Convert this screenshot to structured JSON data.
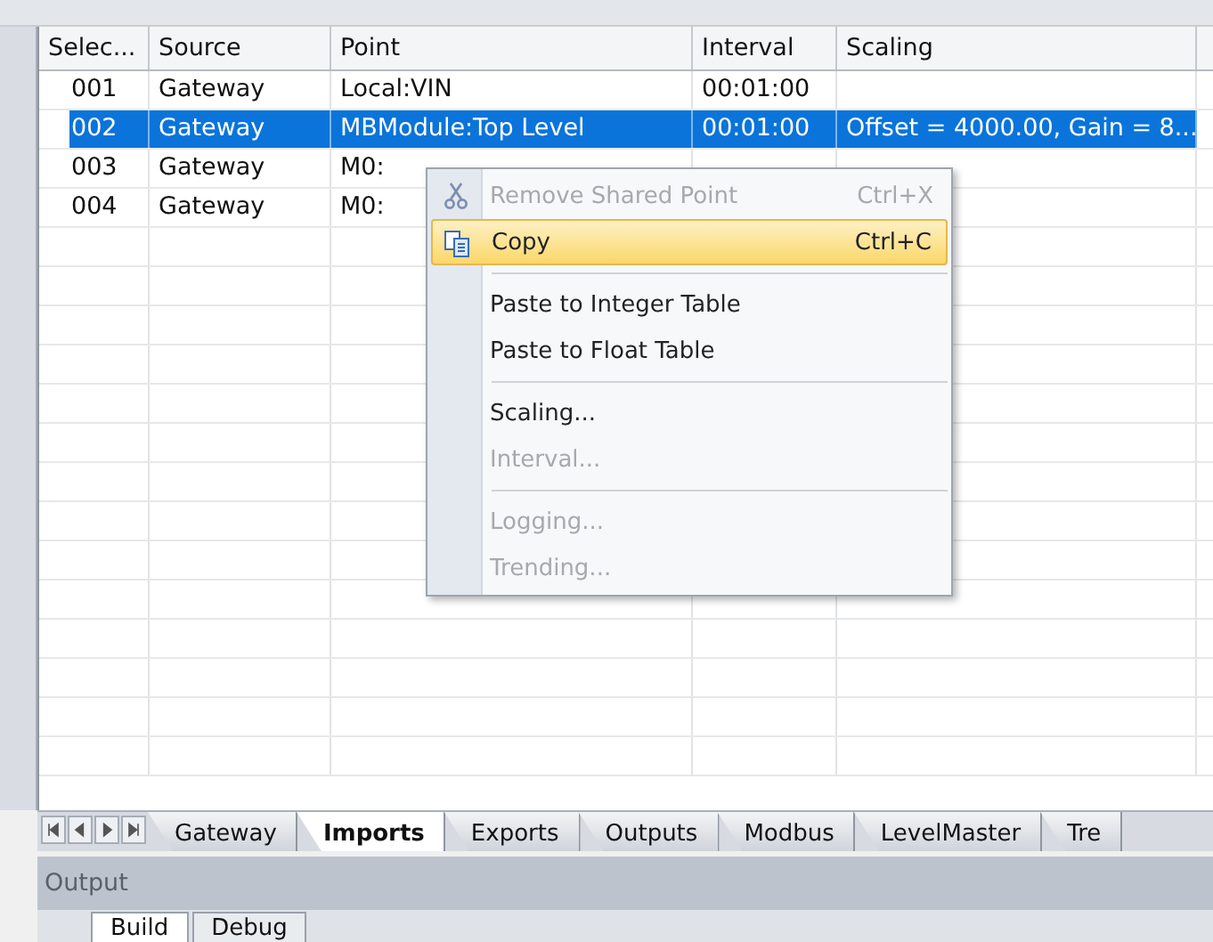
{
  "table": {
    "columns": [
      "Selec...",
      "Source",
      "Point",
      "Interval",
      "Scaling"
    ],
    "rows": [
      {
        "cells": [
          "001",
          "Gateway",
          "Local:VIN",
          "00:01:00",
          ""
        ],
        "selected": false
      },
      {
        "cells": [
          "002",
          "Gateway",
          "MBModule:Top Level",
          "00:01:00",
          "Offset = 4000.00, Gain = 8..."
        ],
        "selected": true
      },
      {
        "cells": [
          "003",
          "Gateway",
          "M0:",
          "",
          ""
        ],
        "selected": false
      },
      {
        "cells": [
          "004",
          "Gateway",
          "M0:",
          "",
          ""
        ],
        "selected": false
      }
    ]
  },
  "context_menu": {
    "items": [
      {
        "kind": "item",
        "label": "Remove Shared Point",
        "shortcut": "Ctrl+X",
        "disabled": true,
        "selected": false
      },
      {
        "kind": "item",
        "label": "Copy",
        "shortcut": "Ctrl+C",
        "disabled": false,
        "selected": true
      },
      {
        "kind": "separator"
      },
      {
        "kind": "item",
        "label": "Paste to Integer Table",
        "disabled": false,
        "selected": false
      },
      {
        "kind": "item",
        "label": "Paste to Float Table",
        "disabled": false,
        "selected": false
      },
      {
        "kind": "separator"
      },
      {
        "kind": "item",
        "label": "Scaling...",
        "disabled": false,
        "selected": false
      },
      {
        "kind": "item",
        "label": "Interval...",
        "disabled": true,
        "selected": false
      },
      {
        "kind": "separator"
      },
      {
        "kind": "item",
        "label": "Logging...",
        "disabled": true,
        "selected": false
      },
      {
        "kind": "item",
        "label": "Trending...",
        "disabled": true,
        "selected": false
      }
    ]
  },
  "sheet_tabs": [
    {
      "label": "Gateway",
      "selected": false
    },
    {
      "label": "Imports",
      "selected": true
    },
    {
      "label": "Exports",
      "selected": false
    },
    {
      "label": "Outputs",
      "selected": false
    },
    {
      "label": "Modbus",
      "selected": false
    },
    {
      "label": "LevelMaster",
      "selected": false
    },
    {
      "label": "Tre",
      "selected": false
    }
  ],
  "output_panel": {
    "title": "Output",
    "tabs": [
      {
        "label": "Build",
        "selected": true
      },
      {
        "label": "Debug",
        "selected": false
      }
    ]
  }
}
